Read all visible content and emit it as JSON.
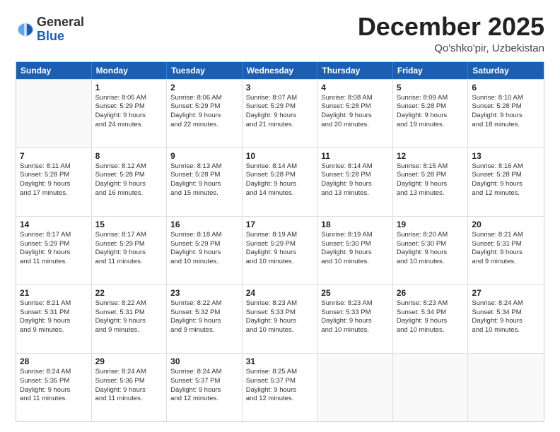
{
  "header": {
    "logo_general": "General",
    "logo_blue": "Blue",
    "main_title": "December 2025",
    "subtitle": "Qo'shko'pir, Uzbekistan"
  },
  "calendar": {
    "days_of_week": [
      "Sunday",
      "Monday",
      "Tuesday",
      "Wednesday",
      "Thursday",
      "Friday",
      "Saturday"
    ],
    "rows": [
      [
        {
          "day": "",
          "info": ""
        },
        {
          "day": "1",
          "info": "Sunrise: 8:05 AM\nSunset: 5:29 PM\nDaylight: 9 hours\nand 24 minutes."
        },
        {
          "day": "2",
          "info": "Sunrise: 8:06 AM\nSunset: 5:29 PM\nDaylight: 9 hours\nand 22 minutes."
        },
        {
          "day": "3",
          "info": "Sunrise: 8:07 AM\nSunset: 5:29 PM\nDaylight: 9 hours\nand 21 minutes."
        },
        {
          "day": "4",
          "info": "Sunrise: 8:08 AM\nSunset: 5:28 PM\nDaylight: 9 hours\nand 20 minutes."
        },
        {
          "day": "5",
          "info": "Sunrise: 8:09 AM\nSunset: 5:28 PM\nDaylight: 9 hours\nand 19 minutes."
        },
        {
          "day": "6",
          "info": "Sunrise: 8:10 AM\nSunset: 5:28 PM\nDaylight: 9 hours\nand 18 minutes."
        }
      ],
      [
        {
          "day": "7",
          "info": "Sunrise: 8:11 AM\nSunset: 5:28 PM\nDaylight: 9 hours\nand 17 minutes."
        },
        {
          "day": "8",
          "info": "Sunrise: 8:12 AM\nSunset: 5:28 PM\nDaylight: 9 hours\nand 16 minutes."
        },
        {
          "day": "9",
          "info": "Sunrise: 8:13 AM\nSunset: 5:28 PM\nDaylight: 9 hours\nand 15 minutes."
        },
        {
          "day": "10",
          "info": "Sunrise: 8:14 AM\nSunset: 5:28 PM\nDaylight: 9 hours\nand 14 minutes."
        },
        {
          "day": "11",
          "info": "Sunrise: 8:14 AM\nSunset: 5:28 PM\nDaylight: 9 hours\nand 13 minutes."
        },
        {
          "day": "12",
          "info": "Sunrise: 8:15 AM\nSunset: 5:28 PM\nDaylight: 9 hours\nand 13 minutes."
        },
        {
          "day": "13",
          "info": "Sunrise: 8:16 AM\nSunset: 5:28 PM\nDaylight: 9 hours\nand 12 minutes."
        }
      ],
      [
        {
          "day": "14",
          "info": "Sunrise: 8:17 AM\nSunset: 5:29 PM\nDaylight: 9 hours\nand 11 minutes."
        },
        {
          "day": "15",
          "info": "Sunrise: 8:17 AM\nSunset: 5:29 PM\nDaylight: 9 hours\nand 11 minutes."
        },
        {
          "day": "16",
          "info": "Sunrise: 8:18 AM\nSunset: 5:29 PM\nDaylight: 9 hours\nand 10 minutes."
        },
        {
          "day": "17",
          "info": "Sunrise: 8:19 AM\nSunset: 5:29 PM\nDaylight: 9 hours\nand 10 minutes."
        },
        {
          "day": "18",
          "info": "Sunrise: 8:19 AM\nSunset: 5:30 PM\nDaylight: 9 hours\nand 10 minutes."
        },
        {
          "day": "19",
          "info": "Sunrise: 8:20 AM\nSunset: 5:30 PM\nDaylight: 9 hours\nand 10 minutes."
        },
        {
          "day": "20",
          "info": "Sunrise: 8:21 AM\nSunset: 5:31 PM\nDaylight: 9 hours\nand 9 minutes."
        }
      ],
      [
        {
          "day": "21",
          "info": "Sunrise: 8:21 AM\nSunset: 5:31 PM\nDaylight: 9 hours\nand 9 minutes."
        },
        {
          "day": "22",
          "info": "Sunrise: 8:22 AM\nSunset: 5:31 PM\nDaylight: 9 hours\nand 9 minutes."
        },
        {
          "day": "23",
          "info": "Sunrise: 8:22 AM\nSunset: 5:32 PM\nDaylight: 9 hours\nand 9 minutes."
        },
        {
          "day": "24",
          "info": "Sunrise: 8:23 AM\nSunset: 5:33 PM\nDaylight: 9 hours\nand 10 minutes."
        },
        {
          "day": "25",
          "info": "Sunrise: 8:23 AM\nSunset: 5:33 PM\nDaylight: 9 hours\nand 10 minutes."
        },
        {
          "day": "26",
          "info": "Sunrise: 8:23 AM\nSunset: 5:34 PM\nDaylight: 9 hours\nand 10 minutes."
        },
        {
          "day": "27",
          "info": "Sunrise: 8:24 AM\nSunset: 5:34 PM\nDaylight: 9 hours\nand 10 minutes."
        }
      ],
      [
        {
          "day": "28",
          "info": "Sunrise: 8:24 AM\nSunset: 5:35 PM\nDaylight: 9 hours\nand 11 minutes."
        },
        {
          "day": "29",
          "info": "Sunrise: 8:24 AM\nSunset: 5:36 PM\nDaylight: 9 hours\nand 11 minutes."
        },
        {
          "day": "30",
          "info": "Sunrise: 8:24 AM\nSunset: 5:37 PM\nDaylight: 9 hours\nand 12 minutes."
        },
        {
          "day": "31",
          "info": "Sunrise: 8:25 AM\nSunset: 5:37 PM\nDaylight: 9 hours\nand 12 minutes."
        },
        {
          "day": "",
          "info": ""
        },
        {
          "day": "",
          "info": ""
        },
        {
          "day": "",
          "info": ""
        }
      ]
    ]
  }
}
